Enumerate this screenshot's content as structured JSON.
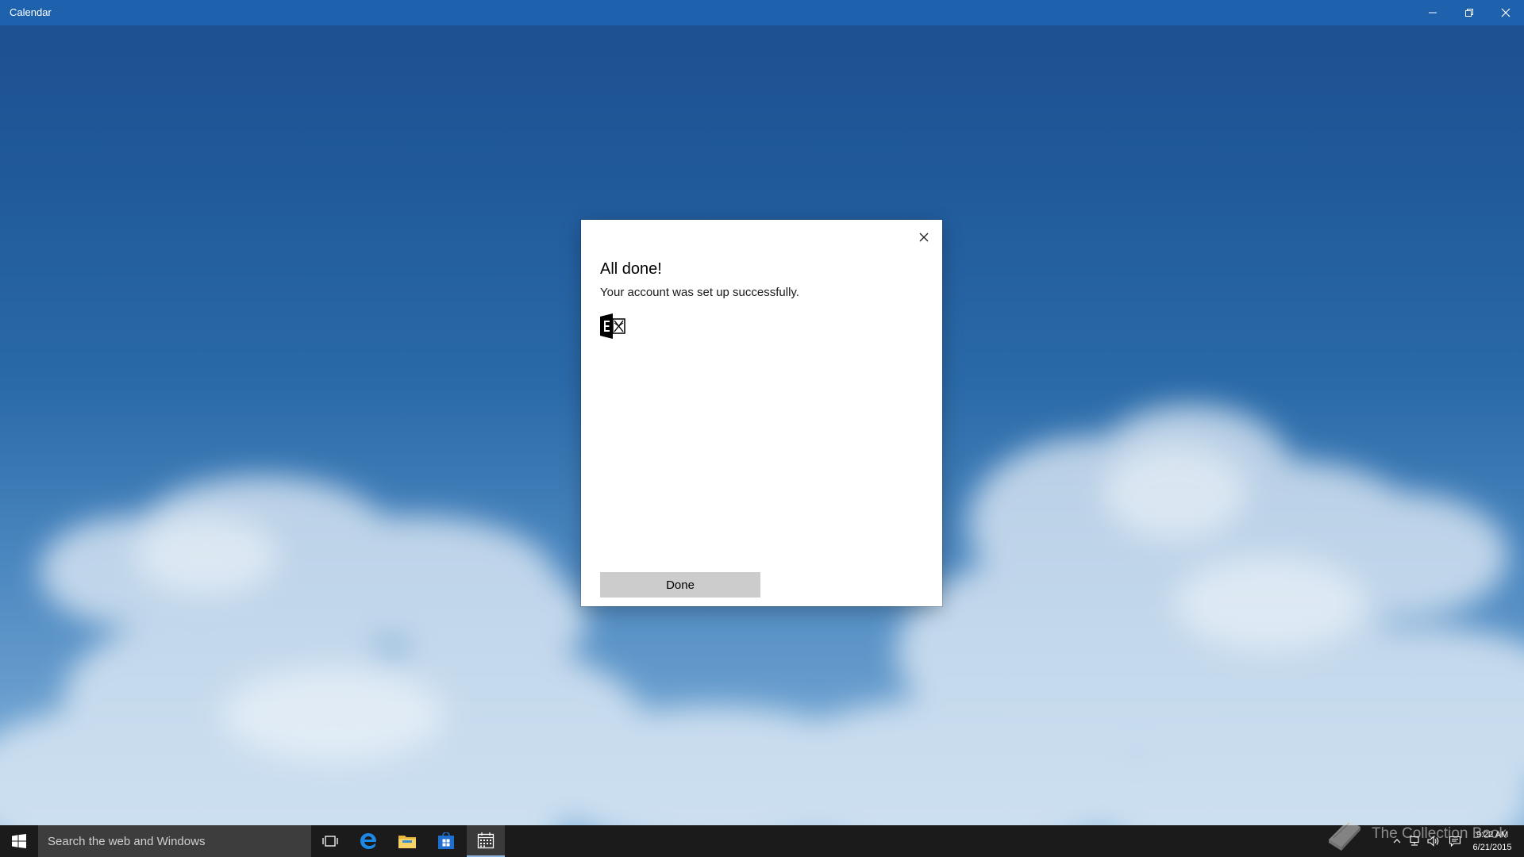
{
  "window": {
    "title": "Calendar",
    "controls": {
      "minimize_icon": "minimize-icon",
      "restore_icon": "restore-icon",
      "close_icon": "close-icon"
    },
    "accent_color": "#1e62ae"
  },
  "dialog": {
    "heading": "All done!",
    "message": "Your account was set up successfully.",
    "account_icon": "exchange-icon",
    "close_icon": "close-icon",
    "done_label": "Done"
  },
  "taskbar": {
    "start_icon": "windows-logo-icon",
    "search_placeholder": "Search the web and Windows",
    "apps": [
      {
        "name": "Task View",
        "icon": "task-view-icon"
      },
      {
        "name": "Microsoft Edge",
        "icon": "edge-icon"
      },
      {
        "name": "File Explorer",
        "icon": "folder-icon"
      },
      {
        "name": "Store",
        "icon": "store-icon"
      },
      {
        "name": "Calendar",
        "icon": "calendar-icon",
        "active": true
      }
    ],
    "watermark_text": "The Collection Book",
    "tray_icons": [
      "chevron-up-icon",
      "network-icon",
      "volume-icon",
      "action-center-icon"
    ],
    "time": "9:22 AM",
    "date": "6/21/2015"
  }
}
